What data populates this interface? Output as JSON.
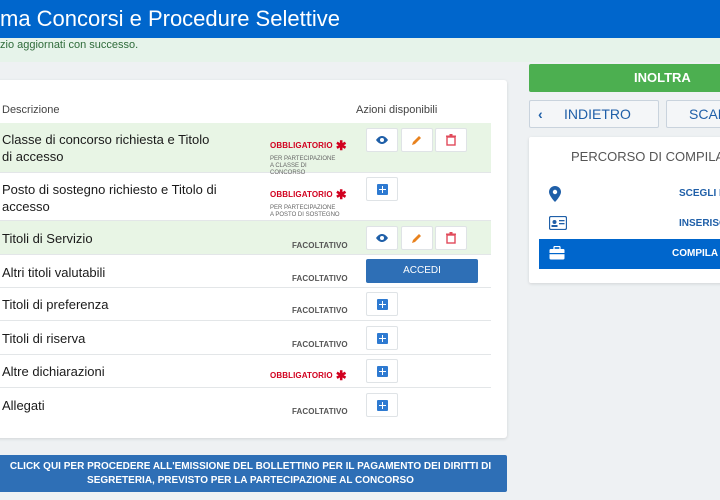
{
  "header": {
    "title": "ma Concorsi e Procedure Selettive"
  },
  "success_message": "zio aggiornati con successo.",
  "table": {
    "col_desc": "Descrizione",
    "col_actions": "Azioni disponibili",
    "rows": [
      {
        "desc": "Classe di concorso richiesta e Titolo di accesso",
        "req": "OBBLIGATORIO",
        "note": "PER PARTECIPAZIONE A CLASSE DI CONCORSO"
      },
      {
        "desc": "Posto di sostegno richiesto e Titolo di accesso",
        "req": "OBBLIGATORIO",
        "note": "PER PARTECIPAZIONE A POSTO DI SOSTEGNO"
      },
      {
        "desc": "Titoli di Servizio",
        "req": "FACOLTATIVO"
      },
      {
        "desc": "Altri titoli valutabili",
        "req": "FACOLTATIVO",
        "action": "ACCEDI"
      },
      {
        "desc": "Titoli di preferenza",
        "req": "FACOLTATIVO"
      },
      {
        "desc": "Titoli di riserva",
        "req": "FACOLTATIVO"
      },
      {
        "desc": "Altre dichiarazioni",
        "req": "OBBLIGATORIO"
      },
      {
        "desc": "Allegati",
        "req": "FACOLTATIVO"
      }
    ]
  },
  "bottom_button": "CLICK QUI PER PROCEDERE ALL'EMISSIONE DEL BOLLETTINO PER IL PAGAMENTO DEI DIRITTI DI SEGRETERIA, PREVISTO PER LA PARTECIPAZIONE AL CONCORSO",
  "sidebar": {
    "inoltra": "INOLTRA",
    "indietro": "INDIETRO",
    "scar": "SCAR",
    "percorso_title": "PERCORSO DI COMPILAZ",
    "steps": [
      "SCEGLI L",
      "INSERISCI",
      "COMPILA"
    ]
  },
  "colors": {
    "primary": "#0066cc",
    "success": "#4caf50",
    "required": "#d1001f"
  }
}
